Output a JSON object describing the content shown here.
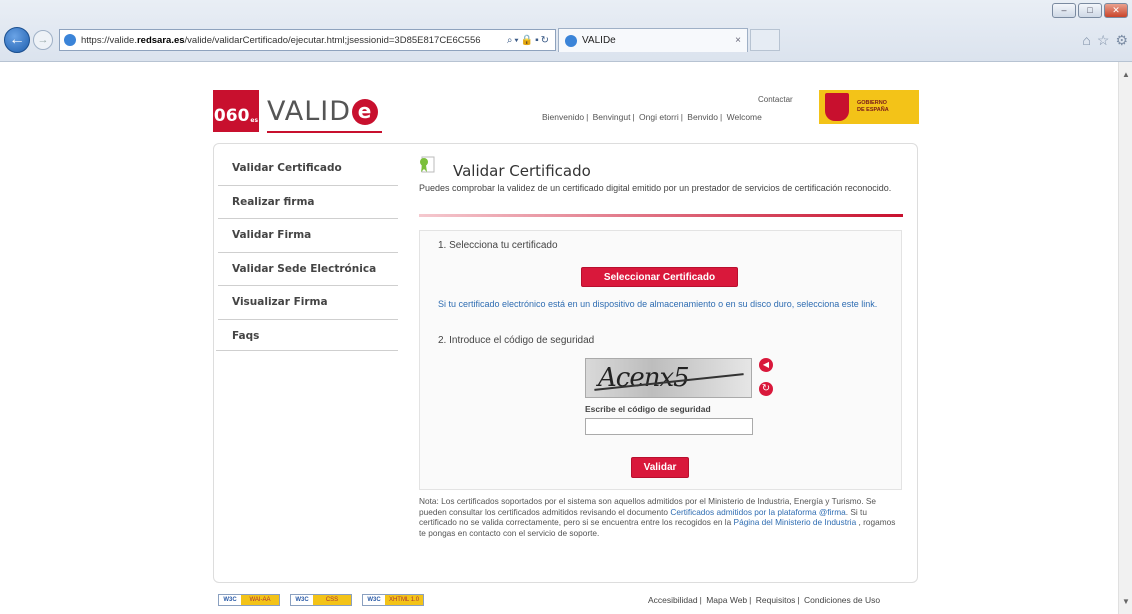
{
  "browser": {
    "url_prefix": "https://valide.",
    "url_domain": "redsara.es",
    "url_rest": "/valide/validarCertificado/ejecutar.html;jsessionid=3D85E817CE6C556",
    "tab_title": "VALIDe",
    "tab_close": "×"
  },
  "header": {
    "logo_060": "060",
    "logo_060_suffix": "es",
    "logo_valide": "VALID",
    "logo_e": "e",
    "contactar": "Contactar",
    "languages": [
      "Bienvenido",
      "Benvingut",
      "Ongi etorri",
      "Benvido",
      "Welcome"
    ],
    "gov_text_1": "GOBIERNO",
    "gov_text_2": "DE ESPAÑA"
  },
  "sidebar": {
    "items": [
      {
        "label": "Validar Certificado"
      },
      {
        "label": "Realizar firma"
      },
      {
        "label": "Validar Firma"
      },
      {
        "label": "Validar Sede Electrónica"
      },
      {
        "label": "Visualizar Firma"
      },
      {
        "label": "Faqs"
      }
    ]
  },
  "main": {
    "title": "Validar Certificado",
    "description": "Puedes comprobar la validez de un certificado digital emitido por un prestador de servicios de certificación reconocido.",
    "step1": "1. Selecciona tu certificado",
    "select_button": "Seleccionar Certificado",
    "link_text": "Si tu certificado electrónico está en un dispositivo de almacenamiento o en su disco duro, selecciona este link.",
    "step2": "2. Introduce el código de seguridad",
    "captcha_text": "Acenx5",
    "captcha_label": "Escribe el código de seguridad",
    "captcha_value": "",
    "validate_button": "Validar",
    "note_part1": "Nota: Los certificados soportados por el sistema son aquellos admitidos por el Ministerio de Industria, Energía y Turismo. Se pueden consultar los certificados admitidos revisando el documento",
    "note_link1": "Certificados admitidos por la plataforma @firma",
    "note_part2": ". Si tu certificado no se valida correctamente, pero si se encuentra entre los recogidos en la",
    "note_link2": "Página del Ministerio de Industria",
    "note_part3": ", rogamos te pongas en contacto con el servicio de soporte."
  },
  "footer": {
    "badges": [
      {
        "w3": "W3C",
        "label": "WAI-AA"
      },
      {
        "w3": "W3C",
        "label": "CSS"
      },
      {
        "w3": "W3C",
        "label": "XHTML 1.0"
      }
    ],
    "links": [
      "Accesibilidad",
      "Mapa Web",
      "Requisitos",
      "Condiciones de Uso"
    ]
  }
}
